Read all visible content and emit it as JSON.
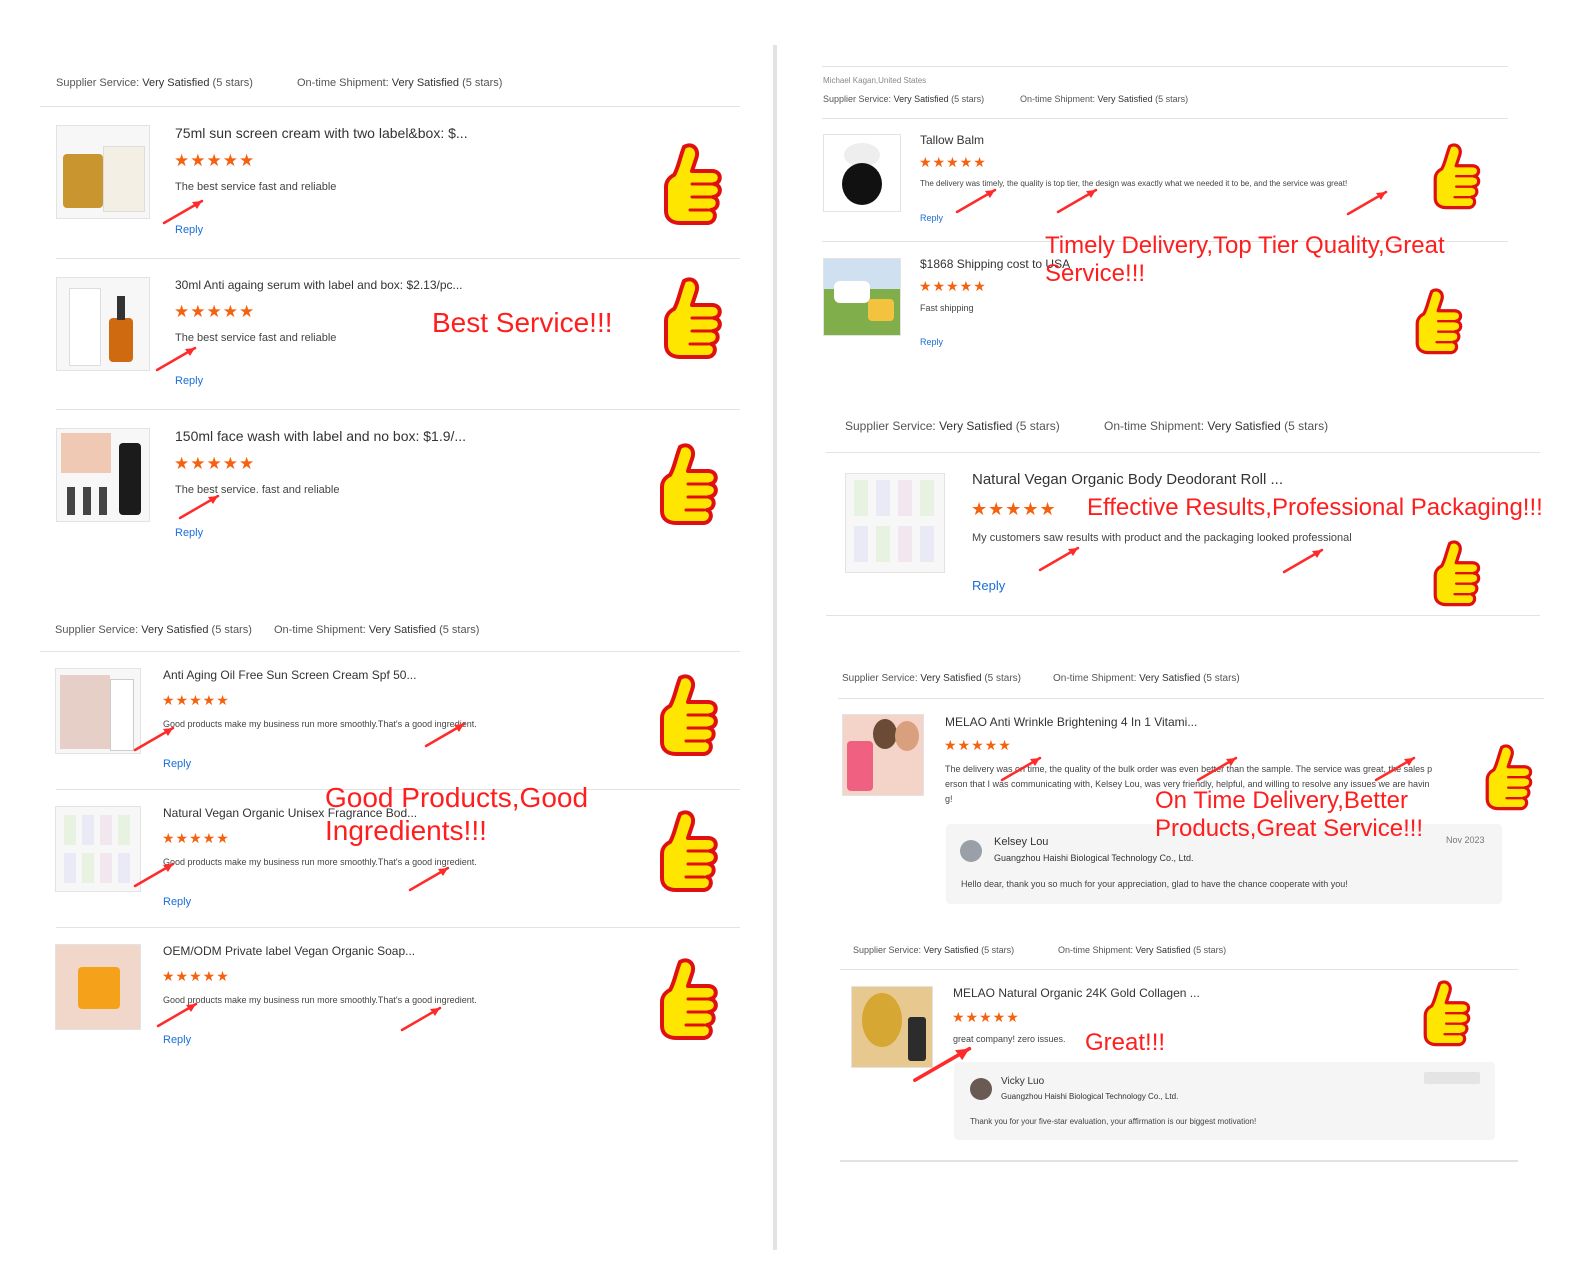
{
  "labels": {
    "supplier_service": "Supplier Service:",
    "ontime_shipment": "On-time Shipment:",
    "very_satisfied": "Very Satisfied",
    "five_stars": "(5 stars)",
    "reply": "Reply",
    "stars": "★★★★★"
  },
  "left": {
    "group1": {
      "reviews": [
        {
          "title": "75ml sun screen cream with two label&box: $...",
          "comment": "The best service fast and reliable"
        },
        {
          "title": "30ml Anti againg serum with label and box: $2.13/pc...",
          "comment": "The best service fast and reliable"
        },
        {
          "title": "150ml face wash with label and no box: $1.9/...",
          "comment": "The best service. fast and reliable"
        }
      ],
      "overlay": "Best Service!!!"
    },
    "group2": {
      "reviews": [
        {
          "title": "Anti Aging Oil Free Sun Screen Cream Spf 50...",
          "comment": "Good products make my business run more smoothly.That's a good ingredient."
        },
        {
          "title": "Natural Vegan Organic Unisex Fragrance Bod...",
          "comment": "Good products make my business run more smoothly.That's a good ingredient."
        },
        {
          "title": "OEM/ODM Private label Vegan Organic Soap...",
          "comment": "Good products make my business run more smoothly.That's a good ingredient."
        }
      ],
      "overlay_line1": "Good Products,Good",
      "overlay_line2": "Ingredients!!!"
    }
  },
  "right": {
    "group1": {
      "reviewer": "Michael Kagan,United States",
      "reviews": [
        {
          "title": "Tallow Balm",
          "comment": "The delivery was timely, the quality is top tier, the design was exactly what we needed it to be, and the service was great!"
        },
        {
          "title": "$1868 Shipping cost to USA",
          "comment": "Fast shipping"
        }
      ],
      "overlay_line1": "Timely Delivery,Top Tier Quality,Great",
      "overlay_line2": "Service!!!"
    },
    "group2": {
      "review": {
        "title": "Natural Vegan Organic Body Deodorant Roll ...",
        "comment": "My customers saw results with product and the packaging looked professional"
      },
      "overlay": "Effective Results,Professional Packaging!!!"
    },
    "group3": {
      "review": {
        "title": "MELAO Anti Wrinkle Brightening 4 In 1 Vitami...",
        "comment_line1": "The delivery was on time, the quality of the bulk order was even better than the sample. The service was great, the sales p",
        "comment_line2": "erson that I was communicating with, Kelsey Lou, was very friendly, helpful, and willing to resolve any issues we are havin",
        "comment_line3": "g!"
      },
      "supplier_reply": {
        "name": "Kelsey Lou",
        "company": "Guangzhou Haishi Biological Technology Co., Ltd.",
        "date": "Nov 2023",
        "text": "Hello dear, thank you so much for your appreciation, glad to have the chance cooperate with you!"
      },
      "overlay_line1": "On Time Delivery,Better",
      "overlay_line2": "Products,Great Service!!!"
    },
    "group4": {
      "review": {
        "title": "MELAO Natural Organic 24K Gold Collagen ...",
        "comment": "great company! zero issues."
      },
      "supplier_reply": {
        "name": "Vicky Luo",
        "company": "Guangzhou Haishi Biological Technology Co., Ltd.",
        "text": "Thank you for your five-star evaluation, your affirmation is our biggest motivation!"
      },
      "overlay": "Great!!!"
    }
  },
  "colors": {
    "star": "#f5620f",
    "overlay_text": "#ff1e1e",
    "link": "#1a6ed8",
    "thumb_fill": "#ffe600",
    "thumb_outline": "#e01010"
  }
}
